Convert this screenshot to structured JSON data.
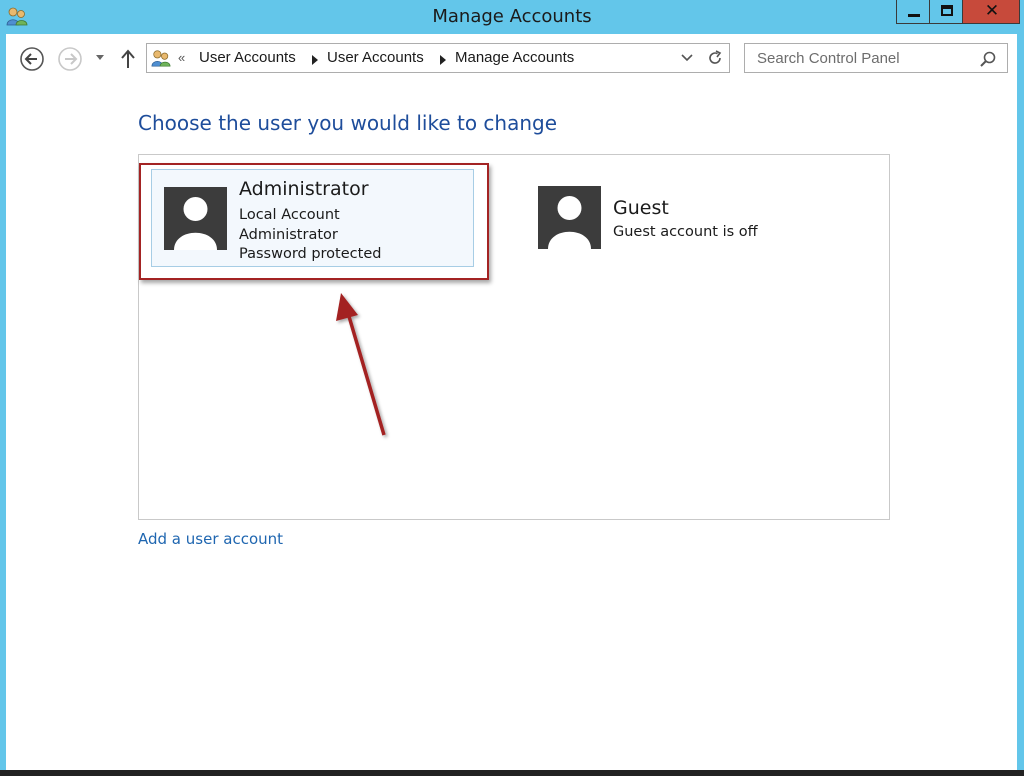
{
  "window": {
    "title": "Manage Accounts",
    "colors": {
      "frame": "#63c6ea",
      "close_button": "#c74a3b",
      "link": "#1f66b0",
      "heading": "#1e4d9b",
      "annotation": "#a32323"
    }
  },
  "titlebar": {
    "icon": "user-accounts-icon",
    "minimize_icon": "minimize-icon",
    "maximize_icon": "maximize-icon",
    "close_label": "✕"
  },
  "nav": {
    "back_icon": "back-arrow-icon",
    "forward_icon": "forward-arrow-icon",
    "recent_icon": "chevron-down-icon",
    "up_icon": "up-arrow-icon"
  },
  "address_bar": {
    "icon": "user-accounts-icon",
    "overflow": "«",
    "crumbs": [
      "User Accounts",
      "User Accounts",
      "Manage Accounts"
    ],
    "dropdown_icon": "chevron-down-icon",
    "refresh_icon": "refresh-icon"
  },
  "search": {
    "placeholder": "Search Control Panel",
    "icon": "search-icon"
  },
  "main": {
    "heading": "Choose the user you would like to change",
    "accounts": [
      {
        "name": "Administrator",
        "details": [
          "Local Account",
          "Administrator",
          "Password protected"
        ],
        "selected": true
      },
      {
        "name": "Guest",
        "details": [
          "Guest account is off"
        ],
        "selected": false
      }
    ],
    "add_link": "Add a user account"
  }
}
